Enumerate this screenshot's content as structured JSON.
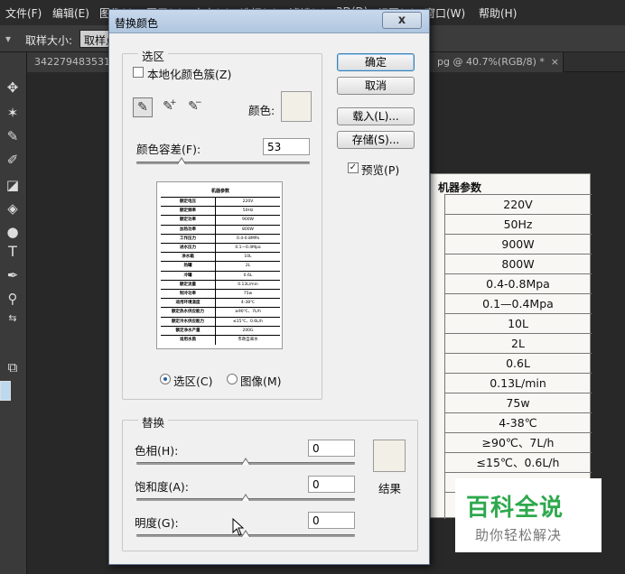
{
  "menubar": {
    "items": [
      "文件(F)",
      "编辑(E)",
      "图像(I)",
      "图层(L)",
      "文字(Y)",
      "选择(S)",
      "滤镜(T)",
      "3D(D)",
      "视图(V)",
      "窗口(W)",
      "帮助(H)"
    ]
  },
  "options_bar": {
    "sample_size_label": "取样大小:",
    "sample_size_value": "取样点"
  },
  "tabs": {
    "doc1": "342279483531",
    "doc2": "pg @ 40.7%(RGB/8) *",
    "doc2_close": "×"
  },
  "spec_table": {
    "title": "机器参数",
    "values": [
      "220V",
      "50Hz",
      "900W",
      "800W",
      "0.4-0.8Mpa",
      "0.1—0.4Mpa",
      "10L",
      "2L",
      "0.6L",
      "0.13L/min",
      "75w",
      "4-38℃",
      "≥90℃、7L/h",
      "≤15℃、0.6L/h"
    ]
  },
  "watermark": {
    "big": "百科全说",
    "small": "助你轻松解决"
  },
  "dialog": {
    "title": "替换颜色",
    "close_label": "x",
    "selection": {
      "group_label": "选区",
      "localized_clusters_label": "本地化颜色簇(Z)",
      "localized_clusters_checked": false,
      "color_label": "颜色:",
      "sample_color": "#f2f0e6",
      "fuzziness_label": "颜色容差(F):",
      "fuzziness_value": "53",
      "fuzziness_level": 0.26,
      "preview_title": "机器参数",
      "preview_rows": [
        {
          "k": "额定电压",
          "v": "220V"
        },
        {
          "k": "额定频率",
          "v": "50Hz"
        },
        {
          "k": "额定功率",
          "v": "900W"
        },
        {
          "k": "加热功率",
          "v": "800W"
        },
        {
          "k": "工作压力",
          "v": "0.4-0.8MPa"
        },
        {
          "k": "进水压力",
          "v": "0.1—0.4Mpa"
        },
        {
          "k": "净水箱",
          "v": "10L"
        },
        {
          "k": "热罐",
          "v": "2L"
        },
        {
          "k": "冷罐",
          "v": "0.6L"
        },
        {
          "k": "额定流量",
          "v": "0.13L/min"
        },
        {
          "k": "制冷功率",
          "v": "75w"
        },
        {
          "k": "适用环境温度",
          "v": "4-38℃"
        },
        {
          "k": "额定热水供应能力",
          "v": "≥90℃、7L/h"
        },
        {
          "k": "额定冷水供应能力",
          "v": "≤15℃、0.6L/h"
        },
        {
          "k": "额定净水产量",
          "v": "200G"
        },
        {
          "k": "适用水质",
          "v": "市政自来水"
        }
      ],
      "view_selection_label": "选区(C)",
      "view_image_label": "图像(M)",
      "view_mode": "selection"
    },
    "buttons": {
      "ok": "确定",
      "cancel": "取消",
      "load": "载入(L)...",
      "save": "存储(S)..."
    },
    "preview_label": "预览(P)",
    "preview_checked": true,
    "replacement": {
      "group_label": "替换",
      "hue_label": "色相(H):",
      "hue_value": "0",
      "hue_level": 0.5,
      "saturation_label": "饱和度(A):",
      "saturation_value": "0",
      "saturation_level": 0.5,
      "lightness_label": "明度(G):",
      "lightness_value": "0",
      "lightness_level": 0.5,
      "result_label": "结果",
      "result_color": "#f2f0e6"
    }
  }
}
